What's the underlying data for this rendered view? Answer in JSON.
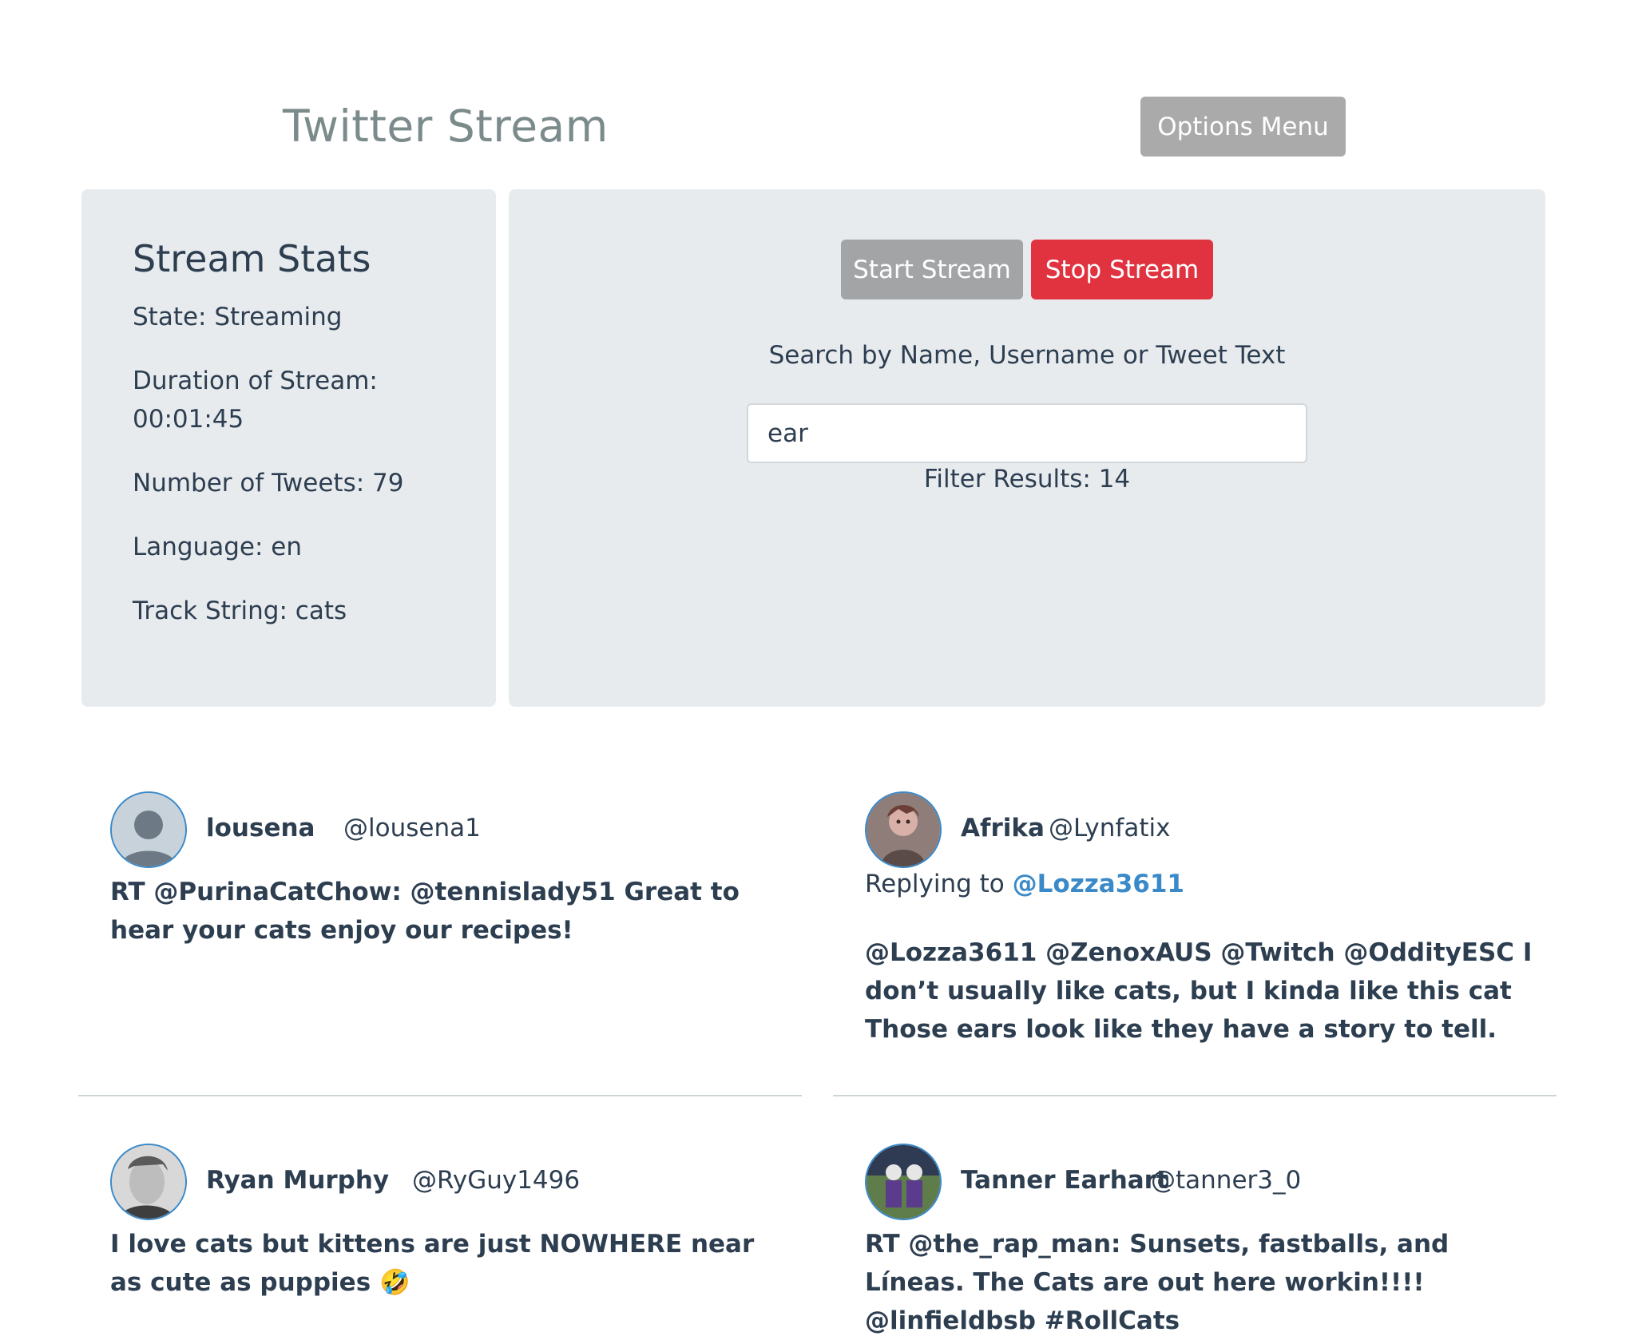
{
  "header": {
    "title": "Twitter Stream",
    "options_label": "Options Menu"
  },
  "stats": {
    "title": "Stream Stats",
    "state": "State: Streaming",
    "duration_label": "Duration of Stream:",
    "duration_value": "00:01:45",
    "tweets": "Number of Tweets: 79",
    "language": "Language: en",
    "track": "Track String: cats"
  },
  "controls": {
    "start_label": "Start Stream",
    "stop_label": "Stop Stream",
    "search_label": "Search by Name, Username or Tweet Text",
    "search_value": "ear",
    "filter_results": "Filter Results: 14"
  },
  "colors": {
    "panel_bg": "#e8ebee",
    "stop_button": "#e0323f",
    "start_button": "#a2a4a6",
    "link": "#3a89c9"
  },
  "tweets": [
    {
      "name": "lousena",
      "handle": "@lousena1",
      "avatar": "default-avatar-icon",
      "text": "RT @PurinaCatChow: @tennislady51 Great to hear your cats enjoy our recipes!"
    },
    {
      "name": "Afrika",
      "handle": "@Lynfatix",
      "avatar": "cartoon-avatar",
      "replying_prefix": "Replying to",
      "replying_to": "@Lozza3611",
      "text": "@Lozza3611 @ZenoxAUS @Twitch @OddityESC I don’t usually like cats, but I kinda like this cat Those ears look like they have a story to tell."
    },
    {
      "name": "Ryan Murphy",
      "handle": "@RyGuy1496",
      "avatar": "photo-avatar",
      "text": "I love cats but kittens are just NOWHERE near as cute as puppies 🤣"
    },
    {
      "name": "Tanner Earhart",
      "handle": "@tanner3_0",
      "avatar": "photo-avatar",
      "text": "RT @the_rap_man: Sunsets, fastballs, and Líneas. The Cats are out here workin!!!! @linfieldbsb #RollCats"
    }
  ]
}
